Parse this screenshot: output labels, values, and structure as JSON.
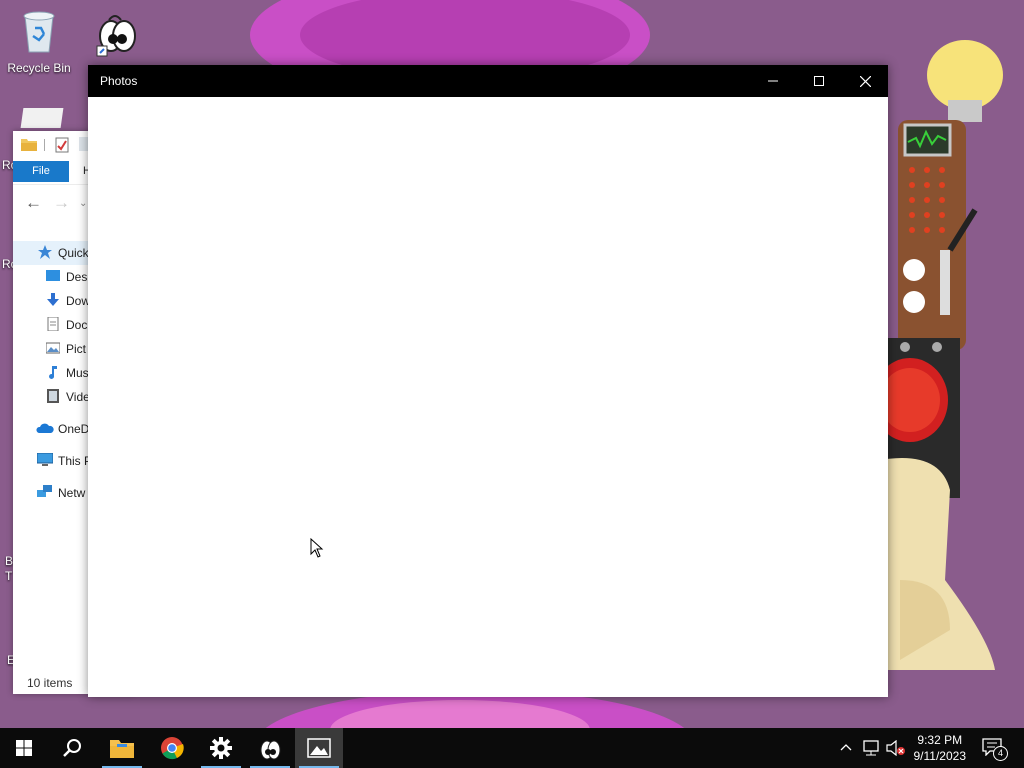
{
  "desktop": {
    "icons": [
      {
        "label": "Recycle Bin",
        "icon": "recycle-bin-icon"
      },
      {
        "label": "",
        "icon": "toontown-shortcut-icon"
      }
    ],
    "partial_labels": [
      "Ro",
      "Ro",
      "B",
      "T",
      "E"
    ]
  },
  "explorer": {
    "tabs": {
      "file": "File",
      "home": "H"
    },
    "tree": [
      {
        "label": "Quick",
        "icon": "star-icon"
      },
      {
        "label": "Desk",
        "icon": "desktop-folder-icon"
      },
      {
        "label": "Dow",
        "icon": "downloads-icon"
      },
      {
        "label": "Doc",
        "icon": "documents-icon"
      },
      {
        "label": "Pict",
        "icon": "pictures-icon"
      },
      {
        "label": "Mus",
        "icon": "music-icon"
      },
      {
        "label": "Vide",
        "icon": "videos-icon"
      },
      {
        "label": "OneD",
        "icon": "onedrive-icon"
      },
      {
        "label": "This P",
        "icon": "this-pc-icon"
      },
      {
        "label": "Netw",
        "icon": "network-icon"
      }
    ],
    "status": "10 items"
  },
  "photos": {
    "title": "Photos",
    "controls": {
      "minimize": "minimize-icon",
      "maximize": "maximize-icon",
      "close": "close-icon"
    }
  },
  "taskbar": {
    "items": [
      "start-icon",
      "search-icon",
      "file-explorer-icon",
      "chrome-icon",
      "settings-icon",
      "toontown-icon",
      "photos-icon"
    ],
    "clock": {
      "time": "9:32 PM",
      "date": "9/11/2023"
    },
    "notifications": "4",
    "accent": "#76b9ed"
  }
}
